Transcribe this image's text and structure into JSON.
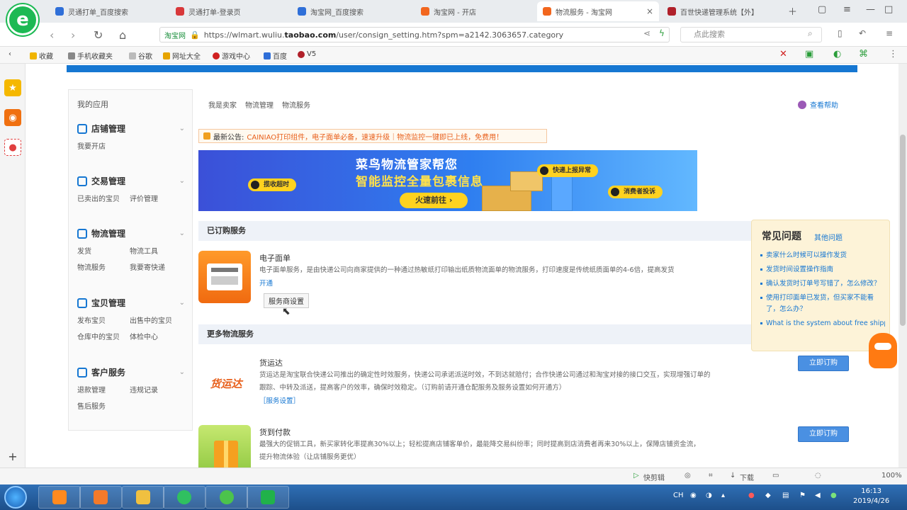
{
  "browser": {
    "tabs": [
      {
        "label": "灵通打单_百度搜索",
        "color": "#2f6fd8"
      },
      {
        "label": "灵通打单-登录页",
        "color": "#d8383a"
      },
      {
        "label": "淘宝网_百度搜索",
        "color": "#2f6fd8"
      },
      {
        "label": "淘宝网 - 开店",
        "color": "#f2661e"
      },
      {
        "label": "物流服务 - 淘宝网",
        "color": "#f2661e",
        "active": true
      },
      {
        "label": "百世快递管理系统【外】",
        "color": "#b0202a"
      }
    ],
    "url_site": "淘宝网",
    "url_prefix": "https://wlmart.wuliu.",
    "url_domain": "taobao.com",
    "url_rest": "/user/consign_setting.htm?spm=a2142.3063657.category",
    "search_placeholder": "点此搜索",
    "bookmarks": [
      "收藏",
      "手机收藏夹",
      "谷歌",
      "网址大全",
      "游戏中心",
      "百度",
      "V5"
    ]
  },
  "sidebar": {
    "title": "我的应用",
    "groups": [
      {
        "title": "店铺管理",
        "links": [
          "我要开店"
        ]
      },
      {
        "title": "交易管理",
        "links": [
          "已卖出的宝贝",
          "评价管理"
        ]
      },
      {
        "title": "物流管理",
        "links": [
          "发货",
          "物流工具",
          "物流服务",
          "我要寄快递"
        ]
      },
      {
        "title": "宝贝管理",
        "links": [
          "发布宝贝",
          "出售中的宝贝",
          "仓库中的宝贝",
          "体检中心"
        ]
      },
      {
        "title": "客户服务",
        "links": [
          "退款管理",
          "违规记录",
          "售后服务"
        ]
      }
    ]
  },
  "breadcrumb": [
    "我是卖家",
    "物流管理",
    "物流服务"
  ],
  "help_label": "查看帮助",
  "notice": {
    "prefix": "最新公告:",
    "text": "CAINIAO打印组件，电子面单必备，速速升级｜物流监控一键即已上线，免费用！"
  },
  "banner": {
    "title": "菜鸟物流管家帮您",
    "subtitle": "智能监控全量包裹信息",
    "button": "火速前往 ›",
    "pills": [
      "揽收超时",
      "快递上报异常",
      "消费者投诉"
    ]
  },
  "subscribed": {
    "header": "已订购服务",
    "service": {
      "name": "电子面单",
      "desc": "电子面单服务，是由快递公司向商家提供的一种通过热敏纸打印输出纸质物流面单的物流服务，打印速度是传统纸质面单的4-6倍，提高发货",
      "link": "开通",
      "button": "服务商设置"
    }
  },
  "more": {
    "header": "更多物流服务",
    "services": [
      {
        "name": "货运达",
        "logo_text": "货运达",
        "desc1": "货运达是淘宝联合快递公司推出的确定性时效服务，快递公司承诺派送时效，不到达就赔付；合作快递公司通过和淘宝对接的接口交互，实现增强订单的",
        "desc2": "跟踪、中转及派送，提高客户的效率，确保时效稳定。（订购前请开通仓配服务及服务设置如何开通方）",
        "link": "［服务设置］",
        "button": "立即订购"
      },
      {
        "name": "货到付款",
        "desc1": "最强大的促销工具，新买家转化率提高30%以上；轻松提高店铺客单价，最能降交易纠纷率；同时提高到店消费者再来30%以上，保障店铺资金流，",
        "desc2": "提升物流体验（让店铺服务更优）",
        "button": "立即订购"
      }
    ]
  },
  "faq": {
    "title": "常见问题",
    "more": "其他问题",
    "items": [
      "卖家什么时候可以操作发货",
      "发货时间设置操作指南",
      "确认发货时订单号写错了，怎么修改？",
      "使用打印面单已发货，但买家不能看了，怎么办？",
      "What is the system about free shipping"
    ]
  },
  "statusbar": {
    "items": [
      "快剪辑",
      "下载",
      "100%"
    ]
  },
  "taskbar": {
    "apps": [
      {
        "name": "media-player",
        "color": "#ff8a1f"
      },
      {
        "name": "file-explorer",
        "color": "#f0c040"
      },
      {
        "name": "browser",
        "color": "#30c060"
      },
      {
        "name": "wechat",
        "color": "#4cc34c"
      },
      {
        "name": "spreadsheet",
        "color": "#21b24a"
      }
    ],
    "time": "16:13",
    "date": "2019/4/26"
  }
}
